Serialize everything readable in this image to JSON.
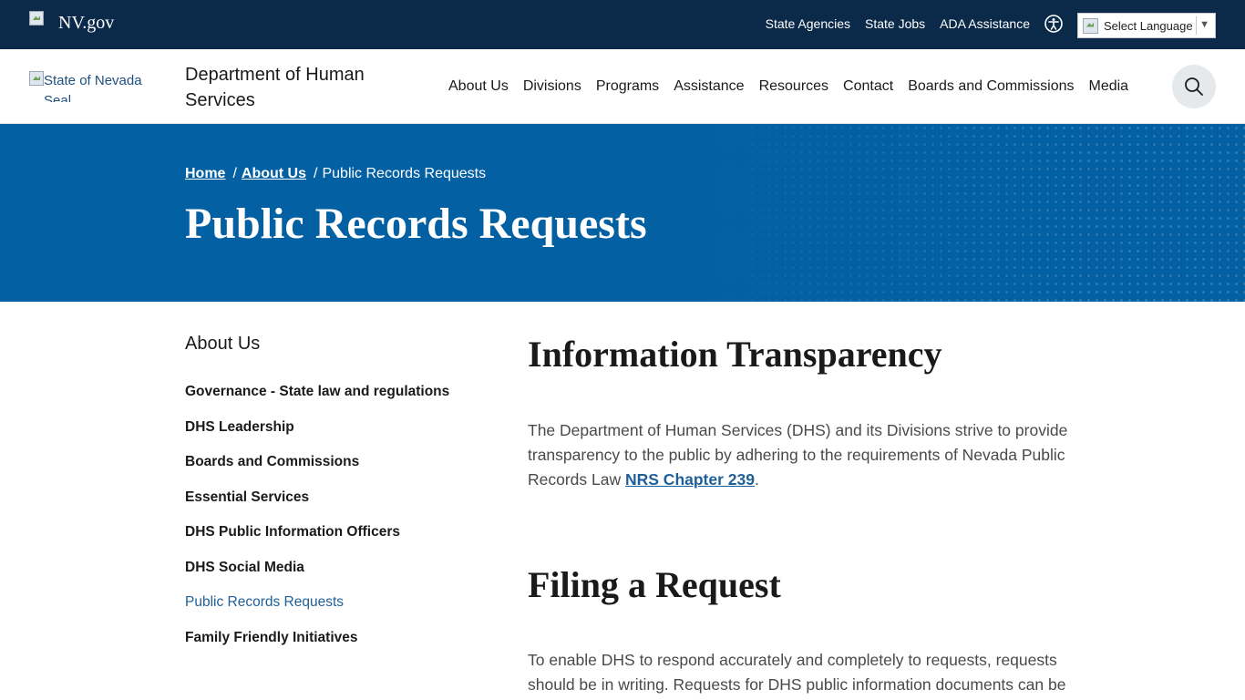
{
  "topbar": {
    "logo_text": "NV.gov",
    "links": [
      "State Agencies",
      "State Jobs",
      "ADA Assistance"
    ],
    "language_select": "Select Language"
  },
  "header": {
    "seal_alt": "State of Nevada Seal",
    "dept_title": "Department of Human Services",
    "nav": [
      "About Us",
      "Divisions",
      "Programs",
      "Assistance",
      "Resources",
      "Contact",
      "Boards and Commissions",
      "Media"
    ]
  },
  "hero": {
    "breadcrumb": {
      "home": "Home",
      "sep": "/",
      "about": "About Us",
      "current": "Public Records Requests"
    },
    "title": "Public Records Requests"
  },
  "sidebar": {
    "title": "About Us",
    "items": [
      "Governance - State law and regulations",
      "DHS Leadership",
      "Boards and Commissions",
      "Essential Services",
      "DHS Public Information Officers",
      "DHS Social Media",
      "Public Records Requests",
      "Family Friendly Initiatives"
    ]
  },
  "content": {
    "info_heading": "Information Transparency",
    "info_text": "The Department of Human Services (DHS) and its Divisions strive to provide transparency to the public by adhering to the requirements of Nevada Public Records Law ",
    "info_link": "NRS Chapter 239",
    "info_end": ".",
    "filing_heading": "Filing a Request",
    "filing_text": "To enable DHS to respond accurately and completely to requests, requests should be in writing. Requests for DHS public information documents can be"
  },
  "colors": {
    "topbar_bg": "#0b2a4a",
    "hero_bg": "#0360a3",
    "link_blue": "#1f5f99"
  }
}
